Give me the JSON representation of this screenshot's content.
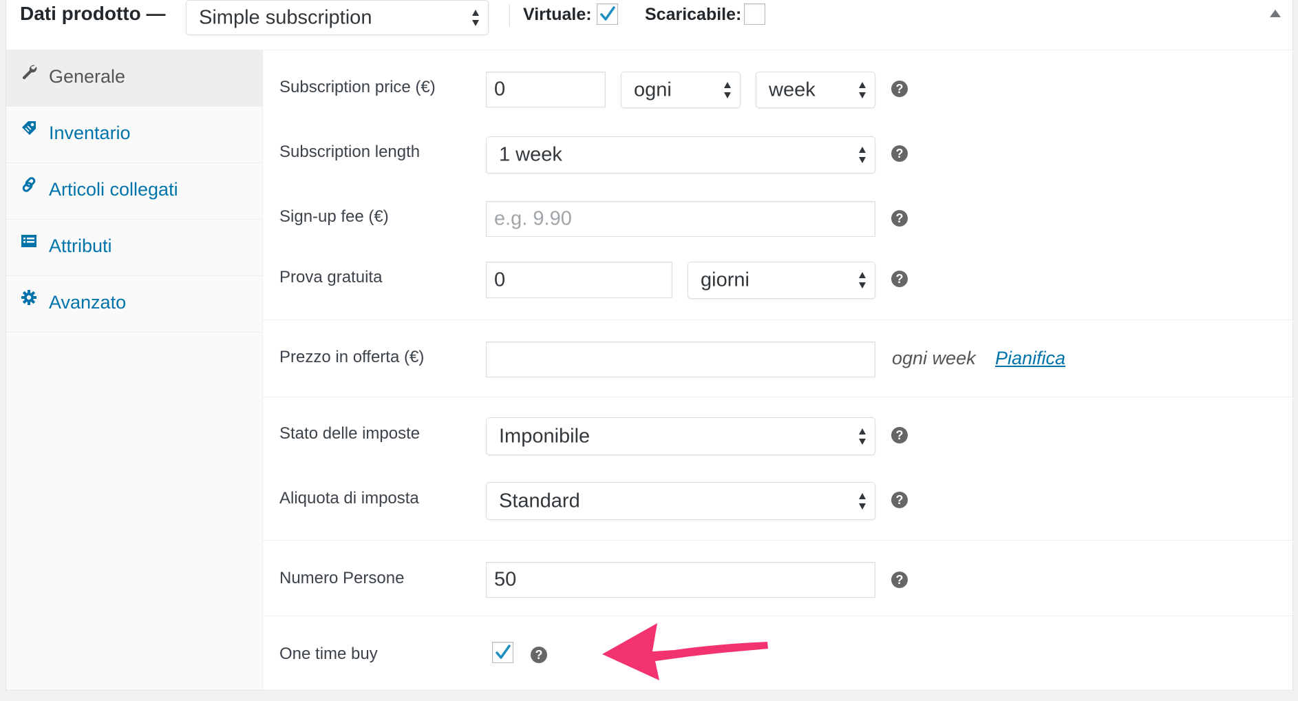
{
  "header": {
    "title": "Dati prodotto —",
    "product_type": "Simple subscription",
    "virtual_label": "Virtuale:",
    "virtual_checked": true,
    "downloadable_label": "Scaricabile:",
    "downloadable_checked": false
  },
  "sidebar": {
    "items": [
      {
        "label": "Generale",
        "icon": "wrench-icon",
        "active": true
      },
      {
        "label": "Inventario",
        "icon": "tag-icon",
        "active": false
      },
      {
        "label": "Articoli collegati",
        "icon": "link-icon",
        "active": false
      },
      {
        "label": "Attributi",
        "icon": "list-icon",
        "active": false
      },
      {
        "label": "Avanzato",
        "icon": "gear-icon",
        "active": false
      }
    ]
  },
  "fields": {
    "subscription_price": {
      "label": "Subscription price (€)",
      "value": "0",
      "interval": "ogni",
      "period": "week"
    },
    "subscription_length": {
      "label": "Subscription length",
      "value": "1 week"
    },
    "signup_fee": {
      "label": "Sign-up fee (€)",
      "placeholder": "e.g. 9.90"
    },
    "free_trial": {
      "label": "Prova gratuita",
      "value": "0",
      "unit": "giorni"
    },
    "sale_price": {
      "label": "Prezzo in offerta (€)",
      "value": "",
      "suffix": "ogni week",
      "schedule_link": "Pianifica"
    },
    "tax_status": {
      "label": "Stato delle imposte",
      "value": "Imponibile"
    },
    "tax_class": {
      "label": "Aliquota di imposta",
      "value": "Standard"
    },
    "num_persons": {
      "label": "Numero Persone",
      "value": "50"
    },
    "one_time_buy": {
      "label": "One time buy",
      "checked": true
    }
  },
  "help_glyph": "?",
  "colors": {
    "accent": "#0073aa",
    "annotation_arrow": "#f2336f",
    "help_icon": "#666666"
  }
}
